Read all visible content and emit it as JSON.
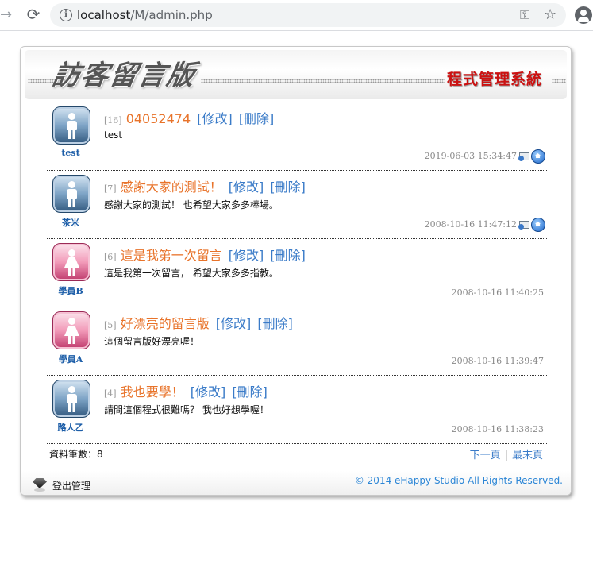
{
  "browser": {
    "url_host": "localhost",
    "url_path": "/M/admin.php",
    "info_icon": "info-icon",
    "key_icon": "key-icon",
    "star_icon": "star-icon",
    "profile_icon": "profile-icon"
  },
  "header": {
    "site_title": "訪客留言版",
    "system_title": "程式管理系統"
  },
  "messages": [
    {
      "num": "[16]",
      "subject": "04052474",
      "edit_label": "[修改]",
      "delete_label": "[刪除]",
      "body": "test",
      "author": "test",
      "time": "2019-06-03 15:34:47",
      "gender": "male",
      "has_mail": true,
      "has_home": true
    },
    {
      "num": "[7]",
      "subject": "感謝大家的測試！",
      "edit_label": "[修改]",
      "delete_label": "[刪除]",
      "body": "感謝大家的測試！ 也希望大家多多棒場。",
      "author": "茶米",
      "time": "2008-10-16 11:47:12",
      "gender": "male",
      "has_mail": true,
      "has_home": true
    },
    {
      "num": "[6]",
      "subject": "這是我第一次留言",
      "edit_label": "[修改]",
      "delete_label": "[刪除]",
      "body": "這是我第一次留言， 希望大家多多指教。",
      "author": "學員B",
      "time": "2008-10-16 11:40:25",
      "gender": "female",
      "has_mail": false,
      "has_home": false
    },
    {
      "num": "[5]",
      "subject": "好漂亮的留言版",
      "edit_label": "[修改]",
      "delete_label": "[刪除]",
      "body": "這個留言版好漂亮喔！",
      "author": "學員A",
      "time": "2008-10-16 11:39:47",
      "gender": "female",
      "has_mail": false,
      "has_home": false
    },
    {
      "num": "[4]",
      "subject": "我也要學！",
      "edit_label": "[修改]",
      "delete_label": "[刪除]",
      "body": "請問這個程式很難嗎？ 我也好想學喔！",
      "author": "路人乙",
      "time": "2008-10-16 11:38:23",
      "gender": "male",
      "has_mail": false,
      "has_home": false
    }
  ],
  "footer": {
    "record_count_label": "資料筆數：8",
    "next_page": "下一頁",
    "separator": "|",
    "last_page": "最末頁",
    "logout_label": "登出管理",
    "copyright": "© 2014 eHappy Studio All Rights Reserved."
  },
  "colors": {
    "subject": "#e8732a",
    "action_link": "#3a7bc8",
    "author": "#1d5ea8",
    "system_title": "#cc1111",
    "copyright": "#2c86d6"
  }
}
